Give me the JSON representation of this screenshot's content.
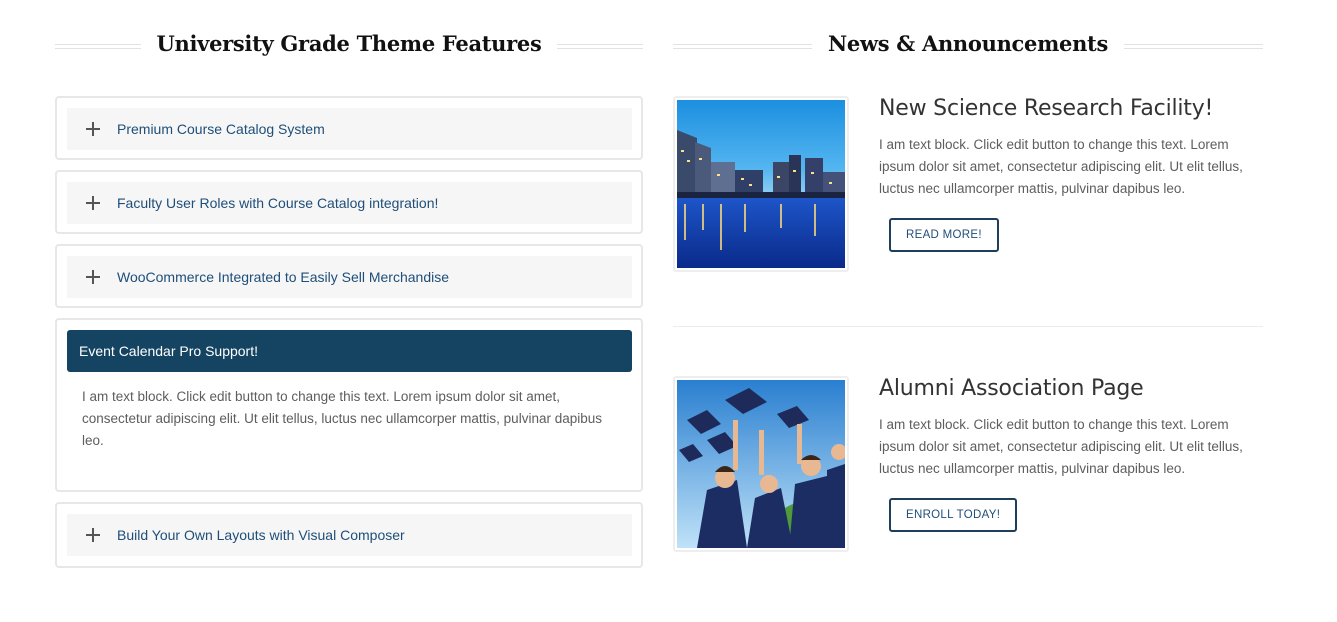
{
  "features": {
    "heading": "University Grade Theme Features",
    "items": [
      {
        "label": "Premium Course Catalog System"
      },
      {
        "label": "Faculty User Roles with Course Catalog integration!"
      },
      {
        "label": "WooCommerce Integrated to Easily Sell Merchandise"
      },
      {
        "label": "Event Calendar Pro Support!",
        "body": "I am text block. Click edit button to change this text. Lorem ipsum dolor sit amet, consectetur adipiscing elit. Ut elit tellus, luctus nec ullamcorper mattis, pulvinar dapibus leo."
      },
      {
        "label": "Build Your Own Layouts with Visual Composer"
      }
    ]
  },
  "news": {
    "heading": "News & Announcements",
    "items": [
      {
        "title": "New Science Research Facility!",
        "text": "I am text block. Click edit button to change this text. Lorem ipsum dolor sit amet, consectetur adipiscing elit. Ut elit tellus, luctus nec ullamcorper mattis, pulvinar dapibus leo.",
        "button": "READ MORE!"
      },
      {
        "title": "Alumni Association Page",
        "text": "I am text block. Click edit button to change this text. Lorem ipsum dolor sit amet, consectetur adipiscing elit. Ut elit tellus, luctus nec ullamcorper mattis, pulvinar dapibus leo.",
        "button": "ENROLL TODAY!"
      }
    ]
  },
  "colors": {
    "accent": "#154463",
    "link": "#1f4e79"
  },
  "icons": {
    "accordion_toggle": "plus-icon"
  }
}
